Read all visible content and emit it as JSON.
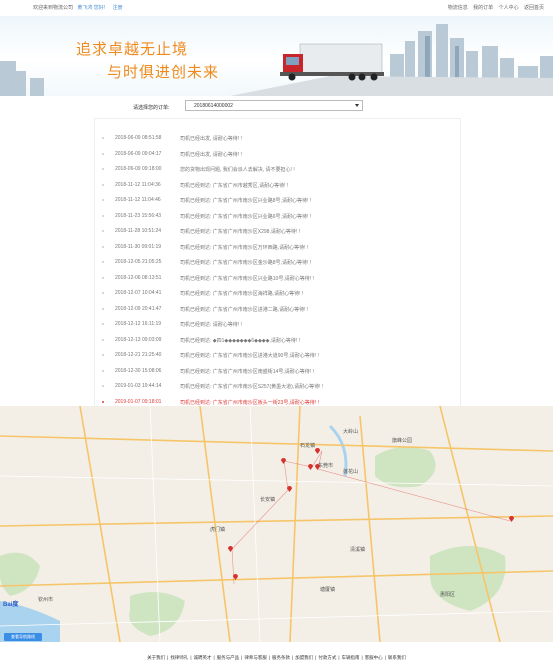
{
  "topbar": {
    "welcome": "欢迎来到物流公司",
    "user_name": "黄飞鸿 您好!",
    "register": "注册",
    "links": [
      "物流信息",
      "我的订单",
      "个人中心",
      "返回首页"
    ]
  },
  "banner": {
    "slogan_line1": "追求卓越无止境",
    "slogan_line2": "与时俱进创未来"
  },
  "order_select": {
    "label": "请选择您的订单:",
    "selected": "20180614000002"
  },
  "timeline": [
    {
      "time": "2018-06-09 08:51:58",
      "msg": "司机已经出发, 请耐心等待! !"
    },
    {
      "time": "2018-06-09 09:04:17",
      "msg": "司机已经出发, 请耐心等待! !"
    },
    {
      "time": "2018-06-09 09:18:00",
      "msg": "您的货物出现问题, 我们会派人去解决, 请不要担心! !"
    },
    {
      "time": "2018-11-12 11:04:36",
      "msg": "司机已经到达: 广东省广州市越秀区,请耐心等待! !"
    },
    {
      "time": "2018-11-12 11:04:46",
      "msg": "司机已经到达: 广东省广州市南沙区兴业路8号,请耐心等待! !"
    },
    {
      "time": "2018-11-23 15:56:43",
      "msg": "司机已经到达: 广东省广州市南沙区兴业路6号,请耐心等待! !"
    },
    {
      "time": "2018-11-28 10:51:24",
      "msg": "司机已经到达: 广东省广州市南沙区X298,请耐心等待! !"
    },
    {
      "time": "2018-11-30 09:01:19",
      "msg": "司机已经到达: 广东省广州市南沙区万环西路,请耐心等待! !"
    },
    {
      "time": "2018-12-05 21:05:25",
      "msg": "司机已经到达: 广东省广州市南沙区金沙路8号,请耐心等待! !"
    },
    {
      "time": "2018-12-06 08:13:51",
      "msg": "司机已经到达: 广东省广州市南沙区兴业路10号,请耐心等待! !"
    },
    {
      "time": "2018-12-07 10:04:41",
      "msg": "司机已经到达: 广东省广州市南沙区海祥路,请耐心等待! !"
    },
    {
      "time": "2018-12-09 20:41:47",
      "msg": "司机已经到达: 广东省广州市南沙区进港二路,请耐心等待! !"
    },
    {
      "time": "2018-12-12 16:11:19",
      "msg": "司机已经到达: 请耐心等待! !"
    },
    {
      "time": "2018-12-13 09:03:09",
      "msg": "司机已经到达: ◆四1◆◆◆◆◆◆◆6◆◆◆◆,请耐心等待! !"
    },
    {
      "time": "2018-12-21 21:25:40",
      "msg": "司机已经到达: 广东省广州市南沙区进港大道90号,请耐心等待! !"
    },
    {
      "time": "2018-12-30 15:08:06",
      "msg": "司机已经到达: 广东省广州市南沙区南盛街14号,请耐心等待! !"
    },
    {
      "time": "2019-01-03 19:44:14",
      "msg": "司机已经到达: 广东省广州市南沙区S257(黄墨大道),请耐心等待! !"
    },
    {
      "time": "2019-01-07 09:18:01",
      "msg": "司机已经到达: 广东省广州市南沙区板头一街23号,请耐心等待! !"
    }
  ],
  "map": {
    "labels": [
      {
        "text": "大岭山"
      },
      {
        "text": "石龙镇"
      },
      {
        "text": "旗峰公园"
      },
      {
        "text": "东莞市"
      },
      {
        "text": "莲花山"
      },
      {
        "text": "长安镇"
      },
      {
        "text": "虎门镇"
      },
      {
        "text": "清溪镇"
      },
      {
        "text": "塘厦镇"
      },
      {
        "text": "惠阳区"
      },
      {
        "text": "钦州市"
      }
    ],
    "logo": "Bai度",
    "nav_button": "查看导航路线"
  },
  "footer": {
    "links": [
      "关于我们",
      "找律师礼",
      "诚聘英才",
      "服务与产品",
      "律师与客服",
      "服务条款",
      "加盟我们",
      "付款方式",
      "车辆指南",
      "客服中心",
      "联系我们"
    ]
  },
  "colors": {
    "accent": "#f08a1c",
    "link": "#4a8fd6",
    "current": "#e03a3a",
    "nav_button": "#3a8ee6"
  }
}
